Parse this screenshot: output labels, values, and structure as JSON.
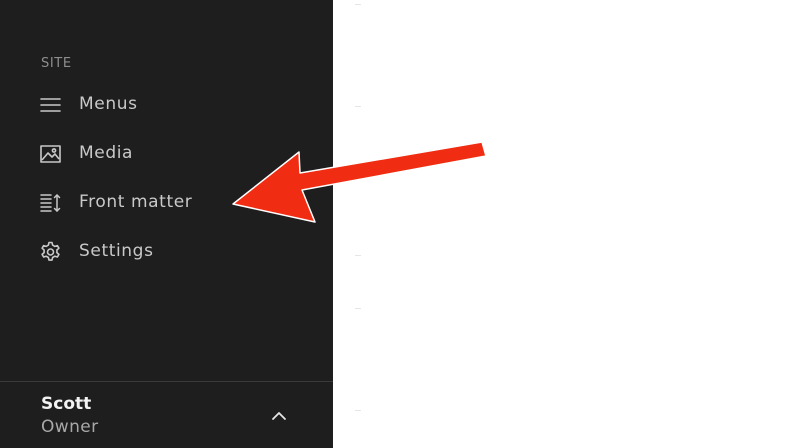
{
  "sidebar": {
    "section_heading": "SITE",
    "items": [
      {
        "label": "Menus",
        "icon": "menu-icon"
      },
      {
        "label": "Media",
        "icon": "image-icon"
      },
      {
        "label": "Front matter",
        "icon": "front-matter-icon"
      },
      {
        "label": "Settings",
        "icon": "gear-icon"
      }
    ]
  },
  "user": {
    "name": "Scott",
    "role": "Owner",
    "toggle_icon": "chevron-up-icon"
  },
  "annotation": {
    "arrow_color": "#f02c12",
    "points_to": "Front matter"
  },
  "colors": {
    "sidebar_background": "#1e1e1e",
    "content_background": "#ffffff"
  }
}
